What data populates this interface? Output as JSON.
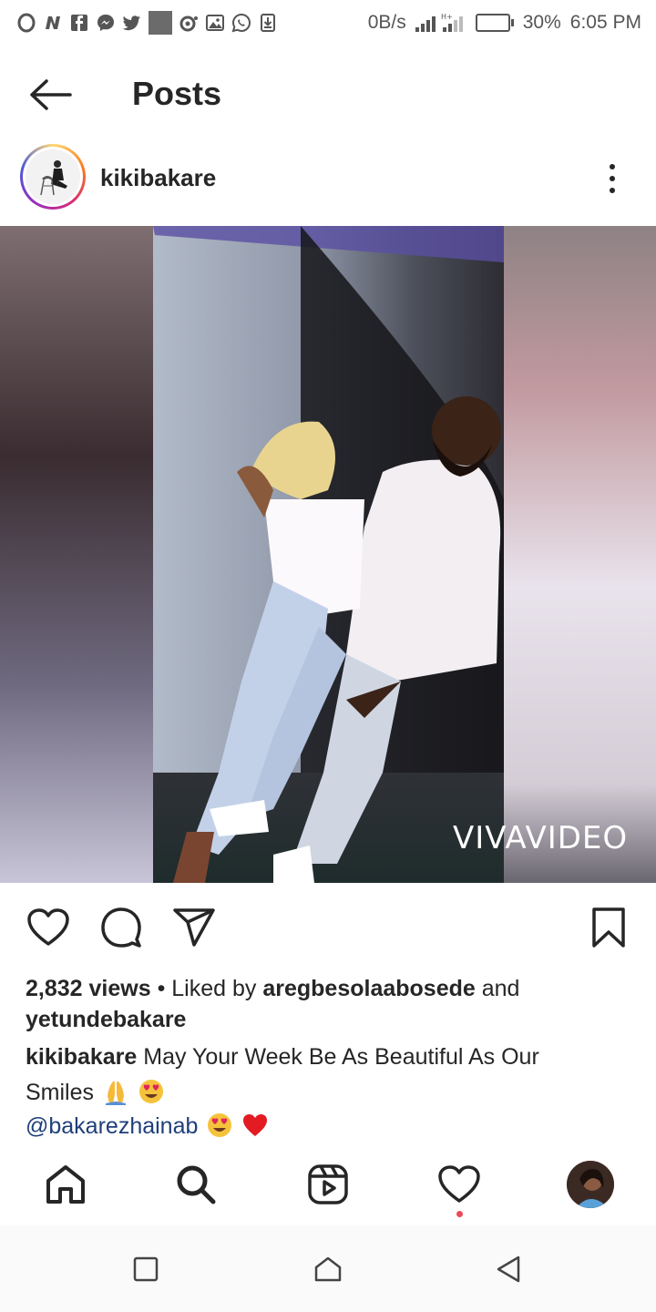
{
  "status_bar": {
    "net_speed": "0B/s",
    "battery_percent": "30%",
    "battery_level": 0.3,
    "time": "6:05 PM",
    "notification_icons": [
      "opera-icon",
      "n-app-icon",
      "facebook-icon",
      "messenger-icon",
      "twitter-icon",
      "app-square-icon",
      "record-icon",
      "gallery-icon",
      "whatsapp-icon",
      "download-icon"
    ]
  },
  "header": {
    "title": "Posts"
  },
  "post": {
    "username": "kikibakare",
    "media_watermark": "VIVAVIDEO",
    "views": "2,832 views",
    "separator": " • ",
    "liked_by_prefix": "Liked by ",
    "liked_by_user1": "aregbesolaabosede",
    "liked_by_and": " and",
    "liked_by_user2": "yetundebakare",
    "caption_user": "kikibakare",
    "caption_line1": " May Your Week Be As Beautiful  As Our",
    "caption_line2": "Smiles",
    "mention": "@bakarezhainab"
  },
  "colors": {
    "text": "#262626",
    "mention": "#1f3f7a",
    "notification_dot": "#ed4956"
  }
}
